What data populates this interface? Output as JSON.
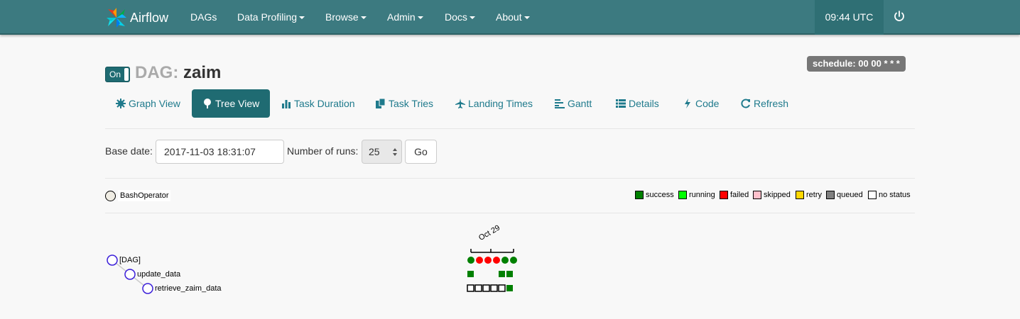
{
  "navbar": {
    "brand": "Airflow",
    "items": [
      {
        "label": "DAGs",
        "dropdown": false
      },
      {
        "label": "Data Profiling",
        "dropdown": true
      },
      {
        "label": "Browse",
        "dropdown": true
      },
      {
        "label": "Admin",
        "dropdown": true
      },
      {
        "label": "Docs",
        "dropdown": true
      },
      {
        "label": "About",
        "dropdown": true
      }
    ],
    "clock": "09:44 UTC",
    "power_icon": "power-icon"
  },
  "dag": {
    "toggle_label": "On",
    "title_prefix": "DAG:",
    "name": "zaim",
    "schedule": "schedule: 00 00 * * *"
  },
  "tabs": [
    {
      "label": "Graph View",
      "icon": "graph-icon",
      "active": false
    },
    {
      "label": "Tree View",
      "icon": "tree-icon",
      "active": true
    },
    {
      "label": "Task Duration",
      "icon": "bar-chart-icon",
      "active": false
    },
    {
      "label": "Task Tries",
      "icon": "copy-icon",
      "active": false
    },
    {
      "label": "Landing Times",
      "icon": "plane-icon",
      "active": false
    },
    {
      "label": "Gantt",
      "icon": "gantt-icon",
      "active": false
    },
    {
      "label": "Details",
      "icon": "list-icon",
      "active": false
    },
    {
      "label": "Code",
      "icon": "flash-icon",
      "active": false
    },
    {
      "label": "Refresh",
      "icon": "refresh-icon",
      "active": false
    }
  ],
  "form": {
    "base_date_label": "Base date:",
    "base_date_value": "2017-11-03 18:31:07",
    "num_runs_label": "Number of runs:",
    "num_runs_value": "25",
    "go_label": "Go"
  },
  "operator": {
    "label": "BashOperator",
    "color": "#f0ede4"
  },
  "legend": [
    {
      "label": "success",
      "color": "#008000"
    },
    {
      "label": "running",
      "color": "#00ff00"
    },
    {
      "label": "failed",
      "color": "#ff0000"
    },
    {
      "label": "skipped",
      "color": "#ffc0cb"
    },
    {
      "label": "retry",
      "color": "#ffd700"
    },
    {
      "label": "queued",
      "color": "#808080"
    },
    {
      "label": "no status",
      "color": "#ffffff"
    }
  ],
  "tree": {
    "date_label": "Oct 29",
    "nodes": [
      {
        "label": "[DAG]"
      },
      {
        "label": "update_data"
      },
      {
        "label": "retrieve_zaim_data"
      }
    ],
    "dag_runs": [
      "success",
      "failed",
      "failed",
      "failed",
      "success",
      "success"
    ],
    "task_rows": [
      [
        "success",
        "none",
        "none",
        "none",
        "success",
        "success"
      ],
      [
        "no status",
        "no status",
        "no status",
        "no status",
        "no status",
        "success"
      ]
    ]
  },
  "colors": {
    "navbar": "#3c7a80",
    "accent": "#1f6b72",
    "link": "#1f7a8c"
  }
}
